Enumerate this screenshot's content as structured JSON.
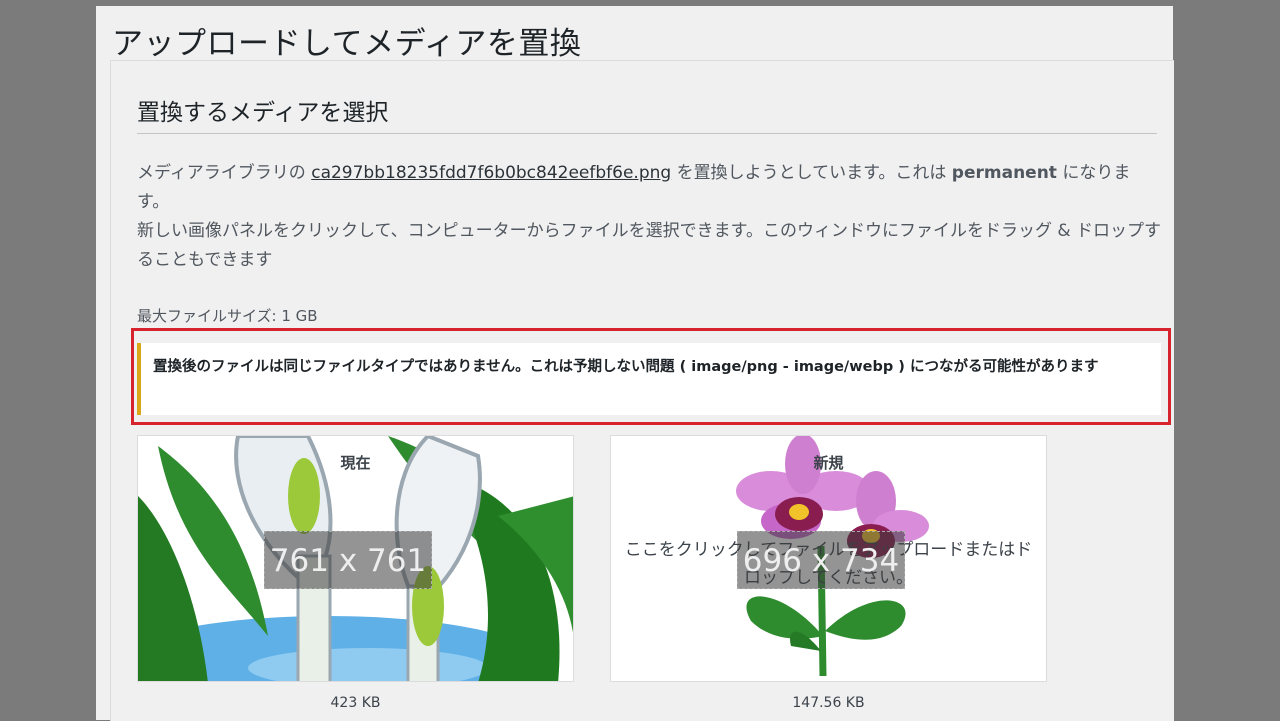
{
  "page": {
    "title": "アップロードしてメディアを置換"
  },
  "section": {
    "title": "置換するメディアを選択",
    "line1_prefix": "メディアライブラリの ",
    "file_name": "ca297bb18235fdd7f6b0bc842eefbf6e.png",
    "line1_middle": " を置換しようとしています。これは ",
    "permanent": "permanent",
    "line1_suffix": " になります。",
    "line2": "新しい画像パネルをクリックして、コンピューターからファイルを選択できます。このウィンドウにファイルをドラッグ & ドロップすることもできます",
    "max_file_size": "最大ファイルサイズ: 1 GB"
  },
  "notice": {
    "text": "置換後のファイルは同じファイルタイプではありません。これは予期しない問題 ( image/png - image/webp ) につながる可能性があります",
    "color": "#dba617"
  },
  "highlight": {
    "color": "#d7232d"
  },
  "current_image": {
    "label": "現在",
    "dimensions": "761 x 761",
    "file_size": "423 KB",
    "icon": "calla-lily-image"
  },
  "new_image": {
    "label": "新規",
    "dimensions": "696 x 734",
    "drop_text": "ここをクリックしてファイルをアップロードまたはドロップしてください。",
    "file_size": "147.56 KB",
    "icon": "orchid-image"
  }
}
